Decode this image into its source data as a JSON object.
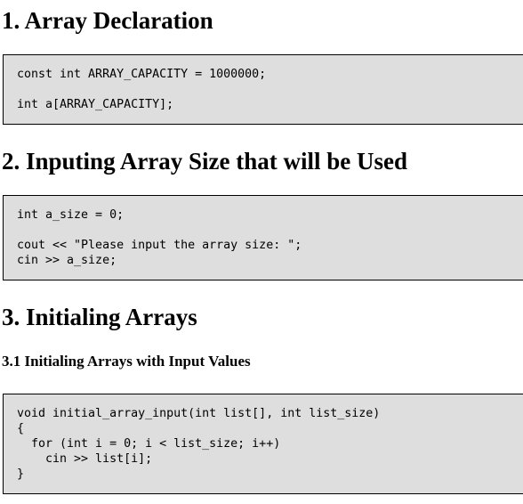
{
  "document": {
    "background_color": "#ffffff",
    "text_color": "#000000",
    "code_background_color": "#dedede",
    "code_border_color": "#000000"
  },
  "sections": [
    {
      "id": "section-1",
      "heading": "1. Array Declaration",
      "code_lines": [
        "const int ARRAY_CAPACITY = 1000000;",
        "",
        "int a[ARRAY_CAPACITY];"
      ]
    },
    {
      "id": "section-2",
      "heading": "2. Inputing Array Size that will be Used",
      "code_lines": [
        "int a_size = 0;",
        "",
        "cout << \"Please input the array size: \";",
        "cin >> a_size;"
      ]
    },
    {
      "id": "section-3",
      "heading": "3. Initialing Arrays",
      "subheading": "3.1 Initialing Arrays with Input Values",
      "code_lines": [
        "void initial_array_input(int list[], int list_size)",
        "{",
        "  for (int i = 0; i < list_size; i++)",
        "    cin >> list[i];",
        "}"
      ]
    }
  ]
}
